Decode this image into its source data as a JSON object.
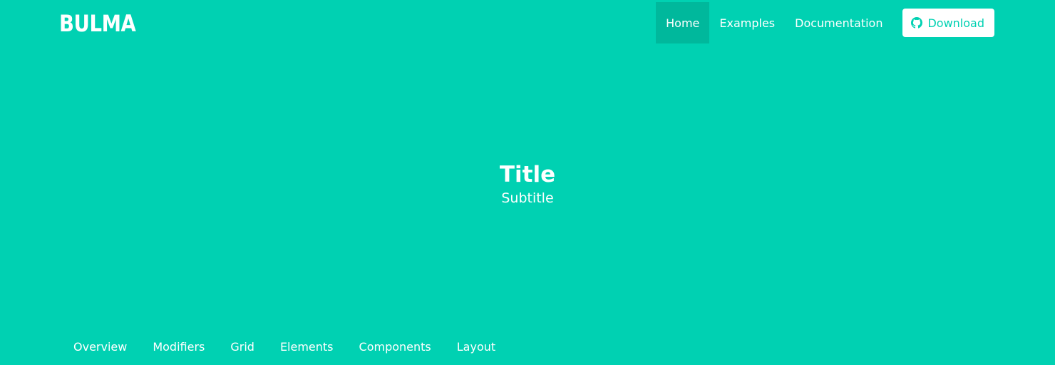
{
  "brand": {
    "logo_text": "BULMA"
  },
  "navbar": {
    "items": [
      {
        "label": "Home",
        "active": true
      },
      {
        "label": "Examples"
      },
      {
        "label": "Documentation"
      }
    ],
    "download": {
      "label": "Download",
      "icon": "github-icon"
    }
  },
  "hero": {
    "title": "Title",
    "subtitle": "Subtitle"
  },
  "tabs": [
    {
      "label": "Overview"
    },
    {
      "label": "Modifiers"
    },
    {
      "label": "Grid"
    },
    {
      "label": "Elements"
    },
    {
      "label": "Components"
    },
    {
      "label": "Layout"
    }
  ],
  "colors": {
    "primary": "#00d1b2",
    "active_nav_bg": "#00b89c",
    "text": "#ffffff"
  }
}
